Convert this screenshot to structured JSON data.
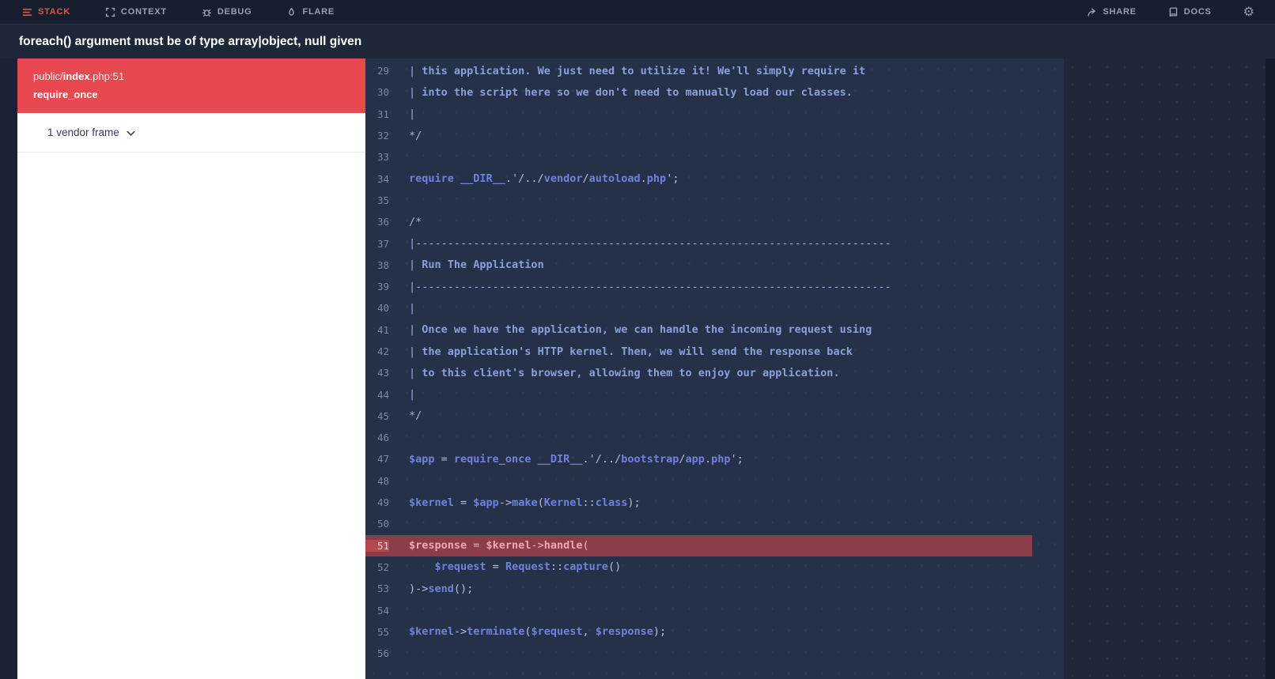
{
  "nav": {
    "tabs": [
      {
        "label": "STACK"
      },
      {
        "label": "CONTEXT"
      },
      {
        "label": "DEBUG"
      },
      {
        "label": "FLARE"
      }
    ],
    "share_label": "SHARE",
    "docs_label": "DOCS",
    "gear_icon": "⚙"
  },
  "error": {
    "message": "foreach() argument must be of type array|object, null given"
  },
  "sidebar": {
    "frame": {
      "dir": "public",
      "slash": "/",
      "file": "index",
      "ext": ".php",
      "colon": ":",
      "line_no": "51",
      "method": "require_once"
    },
    "vendor_toggle": "1 vendor frame"
  },
  "code": {
    "highlight_line": 51,
    "lines": [
      {
        "n": 29,
        "t": [
          [
            "d",
            "| "
          ],
          [
            "c",
            "this application. We just need to utilize it! We'll simply require it"
          ]
        ]
      },
      {
        "n": 30,
        "t": [
          [
            "d",
            "| "
          ],
          [
            "c",
            "into the script here so we don't need to manually load our classes."
          ]
        ]
      },
      {
        "n": 31,
        "t": [
          [
            "d",
            "|"
          ]
        ]
      },
      {
        "n": 32,
        "t": [
          [
            "d",
            "*/"
          ]
        ]
      },
      {
        "n": 33,
        "t": []
      },
      {
        "n": 34,
        "t": [
          [
            "k",
            "require __DIR__"
          ],
          [
            "p",
            ".'/../"
          ],
          [
            "k",
            "vendor"
          ],
          [
            "p",
            "/"
          ],
          [
            "k",
            "autoload"
          ],
          [
            "p",
            "."
          ],
          [
            "k",
            "php"
          ],
          [
            "p",
            "';"
          ]
        ]
      },
      {
        "n": 35,
        "t": []
      },
      {
        "n": 36,
        "t": [
          [
            "d",
            "/*"
          ]
        ]
      },
      {
        "n": 37,
        "t": [
          [
            "d",
            "|--------------------------------------------------------------------------"
          ]
        ]
      },
      {
        "n": 38,
        "t": [
          [
            "d",
            "| "
          ],
          [
            "c",
            "Run The Application"
          ]
        ]
      },
      {
        "n": 39,
        "t": [
          [
            "d",
            "|--------------------------------------------------------------------------"
          ]
        ]
      },
      {
        "n": 40,
        "t": [
          [
            "d",
            "|"
          ]
        ]
      },
      {
        "n": 41,
        "t": [
          [
            "d",
            "| "
          ],
          [
            "c",
            "Once we have the application, we can handle the incoming request using"
          ]
        ]
      },
      {
        "n": 42,
        "t": [
          [
            "d",
            "| "
          ],
          [
            "c",
            "the application's HTTP kernel. Then, we will send the response back"
          ]
        ]
      },
      {
        "n": 43,
        "t": [
          [
            "d",
            "| "
          ],
          [
            "c",
            "to this client's browser, allowing them to enjoy our application."
          ]
        ]
      },
      {
        "n": 44,
        "t": [
          [
            "d",
            "|"
          ]
        ]
      },
      {
        "n": 45,
        "t": [
          [
            "d",
            "*/"
          ]
        ]
      },
      {
        "n": 46,
        "t": []
      },
      {
        "n": 47,
        "t": [
          [
            "k",
            "$app"
          ],
          [
            "p",
            " = "
          ],
          [
            "k",
            "require_once __DIR__"
          ],
          [
            "p",
            ".'/../"
          ],
          [
            "k",
            "bootstrap"
          ],
          [
            "p",
            "/"
          ],
          [
            "k",
            "app"
          ],
          [
            "p",
            "."
          ],
          [
            "k",
            "php"
          ],
          [
            "p",
            "';"
          ]
        ]
      },
      {
        "n": 48,
        "t": []
      },
      {
        "n": 49,
        "t": [
          [
            "k",
            "$kernel"
          ],
          [
            "p",
            " = "
          ],
          [
            "k",
            "$app"
          ],
          [
            "p",
            "->"
          ],
          [
            "k",
            "make"
          ],
          [
            "p",
            "("
          ],
          [
            "k",
            "Kernel"
          ],
          [
            "p",
            "::"
          ],
          [
            "k",
            "class"
          ],
          [
            "p",
            ");"
          ]
        ]
      },
      {
        "n": 50,
        "t": []
      },
      {
        "n": 51,
        "t": [
          [
            "k",
            "$response"
          ],
          [
            "p",
            " = "
          ],
          [
            "k",
            "$kernel"
          ],
          [
            "p",
            "->"
          ],
          [
            "k",
            "handle"
          ],
          [
            "p",
            "("
          ]
        ]
      },
      {
        "n": 52,
        "t": [
          [
            "p",
            "    "
          ],
          [
            "k",
            "$request"
          ],
          [
            "p",
            " = "
          ],
          [
            "k",
            "Request"
          ],
          [
            "p",
            "::"
          ],
          [
            "k",
            "capture"
          ],
          [
            "p",
            "()"
          ]
        ]
      },
      {
        "n": 53,
        "t": [
          [
            "p",
            ")->"
          ],
          [
            "k",
            "send"
          ],
          [
            "p",
            "();"
          ]
        ]
      },
      {
        "n": 54,
        "t": []
      },
      {
        "n": 55,
        "t": [
          [
            "k",
            "$kernel"
          ],
          [
            "p",
            "->"
          ],
          [
            "k",
            "terminate"
          ],
          [
            "p",
            "("
          ],
          [
            "k",
            "$request"
          ],
          [
            "p",
            ", "
          ],
          [
            "k",
            "$response"
          ],
          [
            "p",
            ");"
          ]
        ]
      },
      {
        "n": 56,
        "t": []
      }
    ]
  },
  "colors": {
    "accent_red": "#e8484f",
    "nav_bg": "#171f2e",
    "code_bg": "#253049",
    "highlight_bg": "#8b3d49"
  }
}
